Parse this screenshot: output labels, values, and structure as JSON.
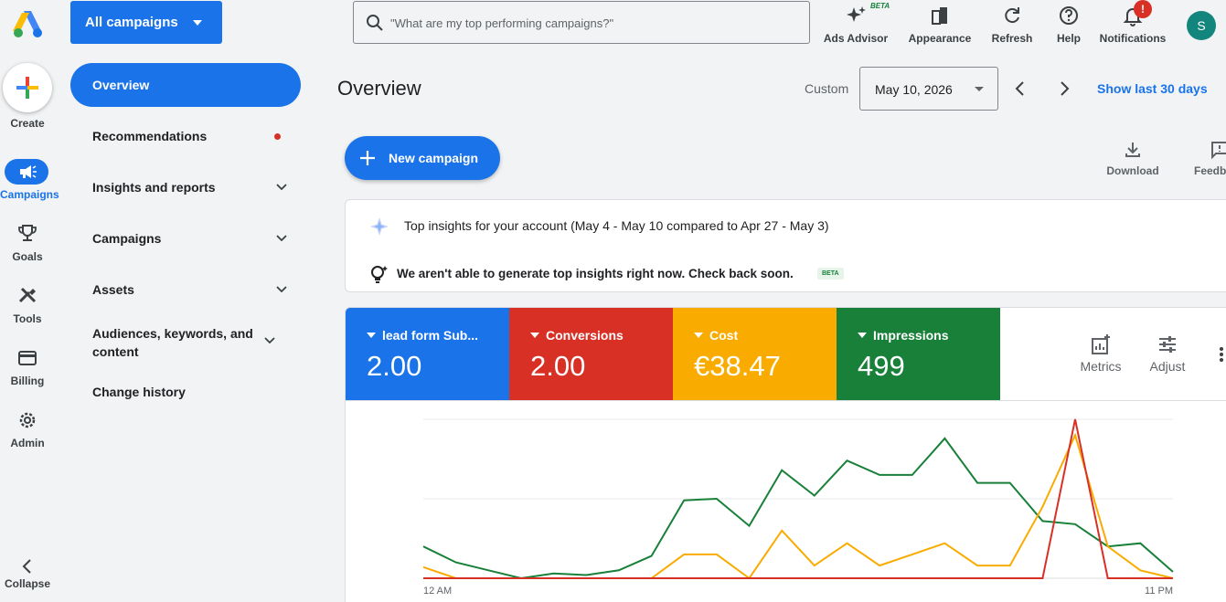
{
  "rail": {
    "create": "Create",
    "campaigns": "Campaigns",
    "goals": "Goals",
    "tools": "Tools",
    "billing": "Billing",
    "admin": "Admin",
    "collapse": "Collapse"
  },
  "nav": {
    "selector": "All campaigns",
    "items": [
      {
        "label": "Overview"
      },
      {
        "label": "Recommendations"
      },
      {
        "label": "Insights and reports"
      },
      {
        "label": "Campaigns"
      },
      {
        "label": "Assets"
      },
      {
        "label": "Audiences, keywords, and content"
      },
      {
        "label": "Change history"
      }
    ]
  },
  "topbar": {
    "search_placeholder": "\"What are my top performing campaigns?\"",
    "ads_advisor": "Ads Advisor",
    "beta": "BETA",
    "appearance": "Appearance",
    "refresh": "Refresh",
    "help": "Help",
    "notifications": "Notifications",
    "notif_badge": "!",
    "avatar": "S"
  },
  "header": {
    "title": "Overview",
    "custom": "Custom",
    "date": "May 10, 2026",
    "show_last": "Show last 30 days"
  },
  "actions": {
    "new_campaign": "New campaign",
    "download": "Download",
    "feedback": "Feedb"
  },
  "insights": {
    "title": "Top insights for your account (May 4 - May 10 compared to Apr 27 - May 3)",
    "message": "We aren't able to generate top insights right now. Check back soon.",
    "beta": "BETA"
  },
  "metrics": {
    "tiles": [
      {
        "name": "lead form Sub...",
        "value": "2.00",
        "color": "#1a73e8"
      },
      {
        "name": "Conversions",
        "value": "2.00",
        "color": "#d93025"
      },
      {
        "name": "Cost",
        "value": "€38.47",
        "color": "#f9ab00"
      },
      {
        "name": "Impressions",
        "value": "499",
        "color": "#188038"
      }
    ],
    "metrics_btn": "Metrics",
    "adjust_btn": "Adjust"
  },
  "chart_data": {
    "type": "line",
    "x_start_label": "12 AM",
    "x_end_label": "11 PM",
    "series": [
      {
        "name": "Impressions",
        "color": "#188038",
        "values": [
          0.2,
          0.1,
          0.05,
          0.0,
          0.03,
          0.02,
          0.05,
          0.14,
          0.49,
          0.5,
          0.33,
          0.68,
          0.52,
          0.74,
          0.65,
          0.65,
          0.88,
          0.6,
          0.6,
          0.36,
          0.34,
          0.2,
          0.22,
          0.04
        ]
      },
      {
        "name": "Cost",
        "color": "#f9ab00",
        "values": [
          0.07,
          0.0,
          0.0,
          0.0,
          0.0,
          0.0,
          0.0,
          0.0,
          0.15,
          0.15,
          0.0,
          0.3,
          0.08,
          0.22,
          0.08,
          0.15,
          0.22,
          0.08,
          0.08,
          0.45,
          0.9,
          0.2,
          0.05,
          0.0
        ]
      },
      {
        "name": "Conversions",
        "color": "#d93025",
        "values": [
          0,
          0,
          0,
          0,
          0,
          0,
          0,
          0,
          0,
          0,
          0,
          0,
          0,
          0,
          0,
          0,
          0,
          0,
          0,
          0,
          1.0,
          0,
          0,
          0
        ]
      }
    ]
  }
}
